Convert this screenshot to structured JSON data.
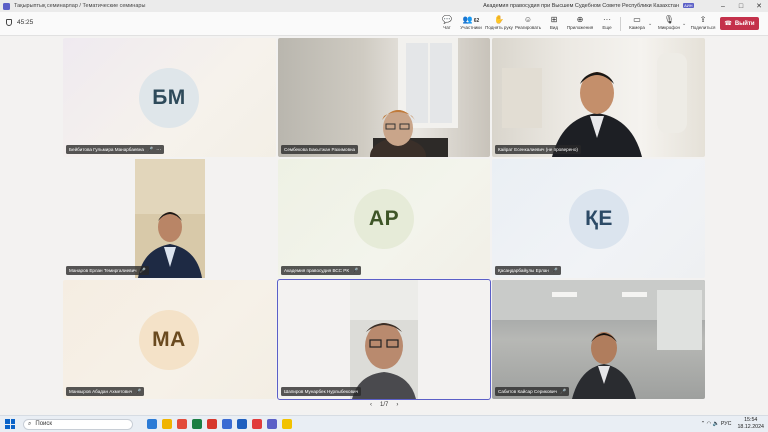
{
  "titlebar": {
    "breadcrumb": "Тақырыптық семинарлар / Тематические семинары",
    "window_title": "Академия правосудия при Высшем Судебном Совете Республики Казахстан",
    "org_tag": "АИН"
  },
  "toolbar": {
    "timer": "45:25",
    "items": [
      {
        "label": "Чат",
        "icon": "chat-icon"
      },
      {
        "label": "Участники",
        "icon": "people-icon",
        "badge": "62"
      },
      {
        "label": "Поднять руку",
        "icon": "hand-icon"
      },
      {
        "label": "Реагировать",
        "icon": "smile-icon"
      },
      {
        "label": "Вид",
        "icon": "grid-icon"
      },
      {
        "label": "Приложения",
        "icon": "apps-icon"
      },
      {
        "label": "Еще",
        "icon": "more-icon"
      },
      {
        "label": "Камера",
        "icon": "camera-icon"
      },
      {
        "label": "Микрофон",
        "icon": "mic-icon"
      },
      {
        "label": "Поделиться",
        "icon": "share-icon"
      }
    ],
    "leave_label": "Выйти"
  },
  "participants": [
    {
      "name": "Бейбитова Гульмира Манарбаевна",
      "initials": "БМ",
      "type": "avatar",
      "avatar_bg": "#dfe6ea",
      "avatar_fg": "#2e4a5a"
    },
    {
      "name": "Сембекова Бакытжан Рахимовна",
      "type": "video"
    },
    {
      "name": "Кайрат Есенкалиевич (не проверено)",
      "type": "video"
    },
    {
      "name": "Манаров Ерлан Темиргалиевич",
      "type": "video"
    },
    {
      "name": "Академия правосудия ВСС РК",
      "initials": "АР",
      "type": "avatar",
      "avatar_bg": "#e6ebd8",
      "avatar_fg": "#3e5527"
    },
    {
      "name": "Қасаңдарбайұлы Ерлан",
      "initials": "ҚЕ",
      "type": "avatar",
      "avatar_bg": "#dbe4ee",
      "avatar_fg": "#2c4a66"
    },
    {
      "name": "Манкыров Абадан Ахметович",
      "initials": "МА",
      "type": "avatar",
      "avatar_bg": "#f4e2c8",
      "avatar_fg": "#6a4a1f"
    },
    {
      "name": "Шапиров Мунарбек Нурлыбекович",
      "type": "video",
      "selected": true
    },
    {
      "name": "Сабитов Кайсар Серикович",
      "type": "video"
    }
  ],
  "pager": {
    "text": "1/7"
  },
  "taskbar": {
    "search_placeholder": "Поиск",
    "lang": "РУС",
    "time": "15:54",
    "date": "18.12.2024"
  },
  "colors": {
    "accent": "#5b5fc7",
    "leave": "#c4314b"
  }
}
